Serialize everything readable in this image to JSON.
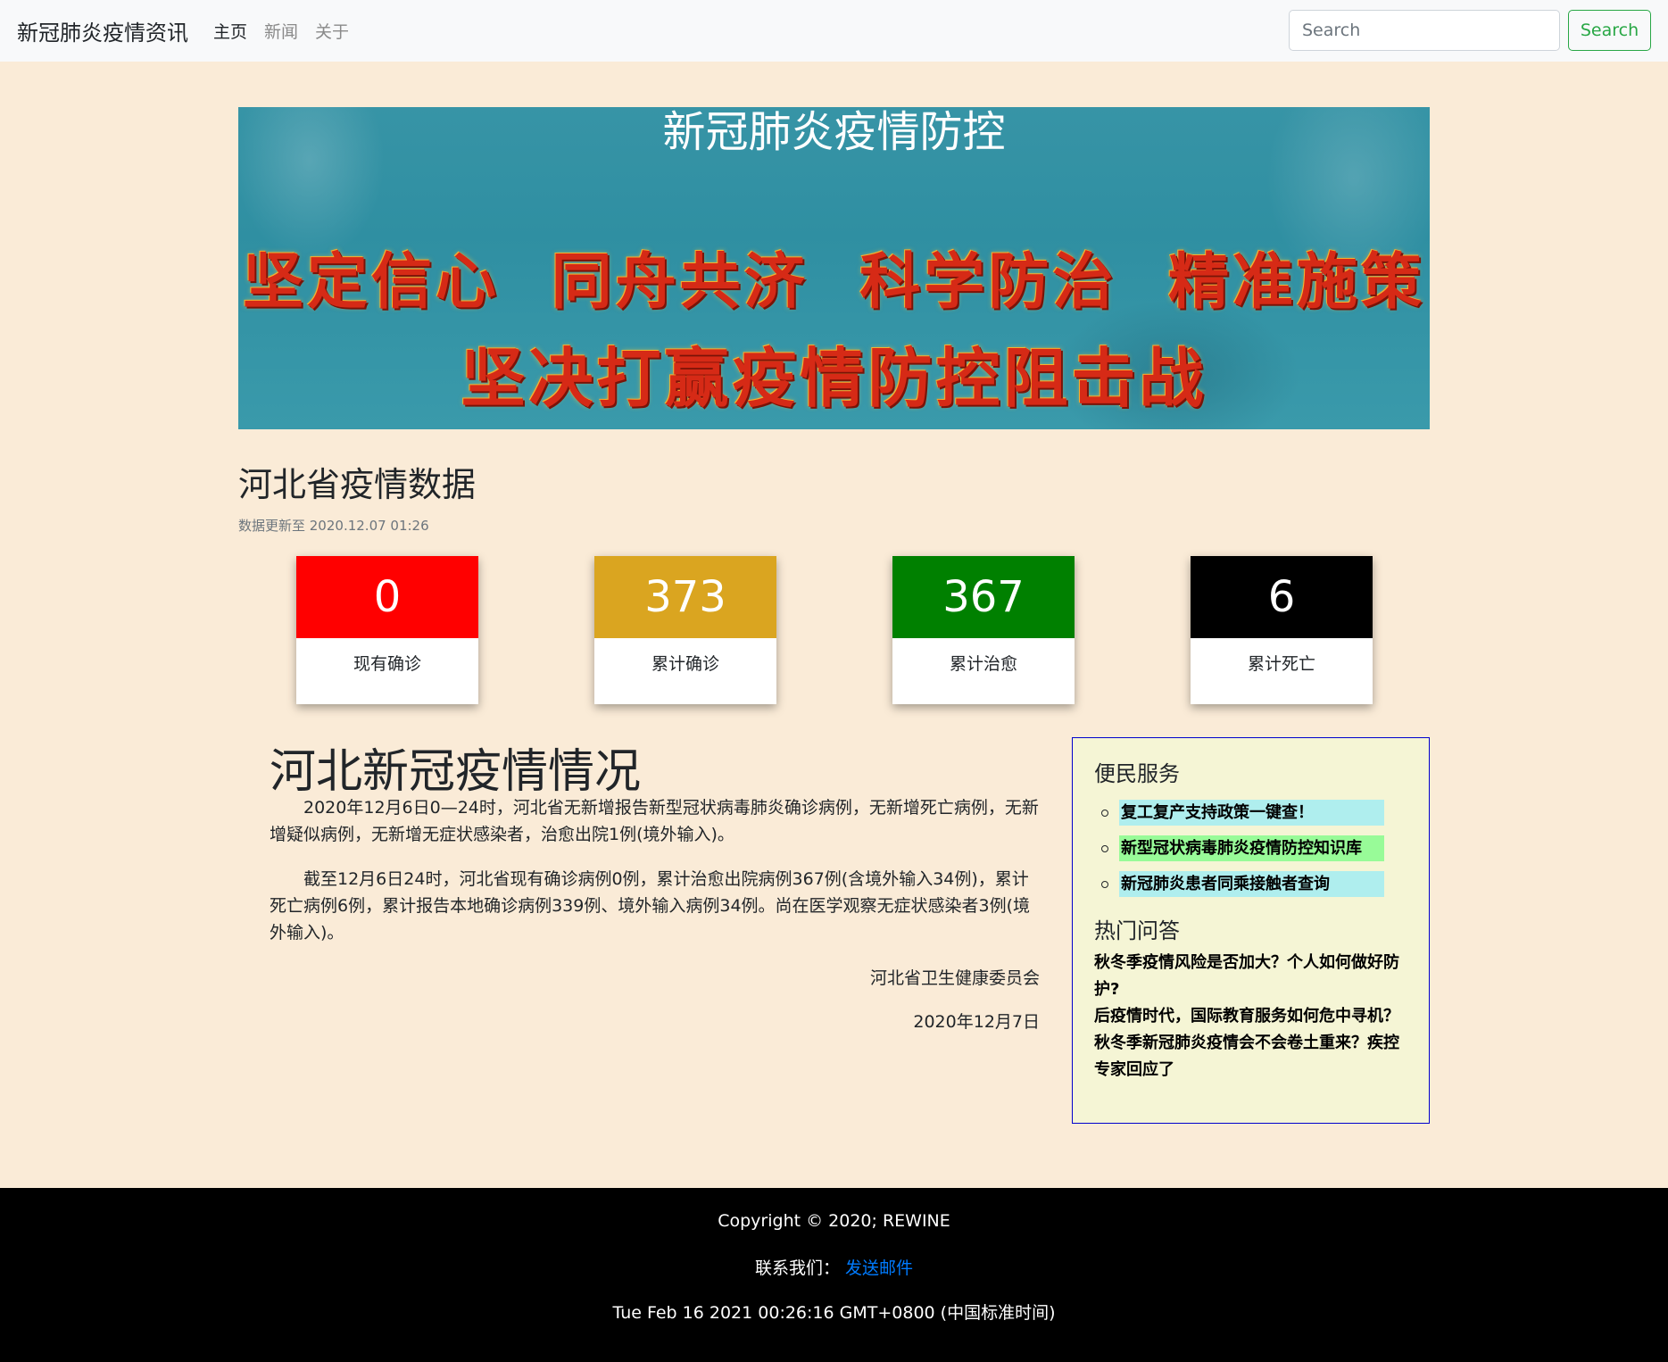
{
  "navbar": {
    "brand": "新冠肺炎疫情资讯",
    "links": [
      {
        "label": "主页",
        "active": true
      },
      {
        "label": "新闻",
        "active": false
      },
      {
        "label": "关于",
        "active": false
      }
    ],
    "search_placeholder": "Search",
    "search_button": "Search"
  },
  "banner": {
    "title": "新冠肺炎疫情防控",
    "slogan_line1": "坚定信心 同舟共济 科学防治 精准施策",
    "slogan_line2": "坚决打赢疫情防控阻击战"
  },
  "stats_section": {
    "title": "河北省疫情数据",
    "update_time": "数据更新至 2020.12.07 01:26",
    "cards": [
      {
        "value": "0",
        "label": "现有确诊",
        "color": "#ff0000"
      },
      {
        "value": "373",
        "label": "累计确诊",
        "color": "#daa520"
      },
      {
        "value": "367",
        "label": "累计治愈",
        "color": "#008000"
      },
      {
        "value": "6",
        "label": "累计死亡",
        "color": "#000000"
      }
    ]
  },
  "article": {
    "title": "河北新冠疫情情况",
    "paragraph1": "2020年12月6日0—24时，河北省无新增报告新型冠状病毒肺炎确诊病例，无新增死亡病例，无新增疑似病例，无新增无症状感染者，治愈出院1例(境外输入)。",
    "paragraph2": "截至12月6日24时，河北省现有确诊病例0例，累计治愈出院病例367例(含境外输入34例)，累计死亡病例6例，累计报告本地确诊病例339例、境外输入病例34例。尚在医学观察无症状感染者3例(境外输入)。",
    "signature": "河北省卫生健康委员会",
    "date": "2020年12月7日"
  },
  "sidebar": {
    "services_title": "便民服务",
    "services": [
      {
        "label": "复工复产支持政策一键查！",
        "color": "#afeeee"
      },
      {
        "label": "新型冠状病毒肺炎疫情防控知识库",
        "color": "#98fb98"
      },
      {
        "label": "新冠肺炎患者同乘接触者查询",
        "color": "#afeeee"
      }
    ],
    "qa_title": "热门问答",
    "questions": [
      "秋冬季疫情风险是否加大？个人如何做好防护?",
      "后疫情时代，国际教育服务如何危中寻机？",
      "秋冬季新冠肺炎疫情会不会卷土重来？疾控专家回应了"
    ]
  },
  "footer": {
    "copyright": "Copyright © 2020; REWINE",
    "contact_prefix": "联系我们：",
    "contact_link": "发送邮件",
    "datetime": "Tue Feb 16 2021 00:26:16 GMT+0800 (中国标准时间)"
  }
}
